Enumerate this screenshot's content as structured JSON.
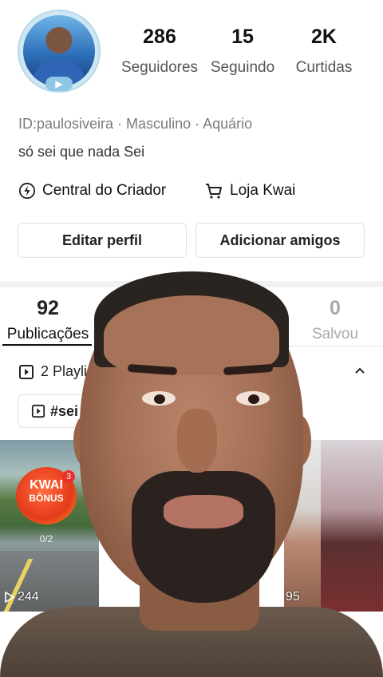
{
  "profile": {
    "stats": [
      {
        "value": "286",
        "label": "Seguidores"
      },
      {
        "value": "15",
        "label": "Seguindo"
      },
      {
        "value": "2K",
        "label": "Curtidas"
      }
    ],
    "meta": "ID:paulosiveira · Masculino · Aquário",
    "bio": "só sei que nada Sei",
    "creator_center": "Central do Criador",
    "shop": "Loja Kwai",
    "edit_profile": "Editar perfil",
    "add_friends": "Adicionar amigos"
  },
  "tabs": [
    {
      "count": "92",
      "label": "Publicações"
    },
    {
      "count": "0",
      "label": "Salvou"
    }
  ],
  "playlist": {
    "label": "2 Playli",
    "chip": "#sei"
  },
  "thumbs": {
    "kwai_title": "KWAI",
    "kwai_sub": "BÔNUS",
    "kwai_badge": "3",
    "progress": "0/2",
    "views_left": "244",
    "views_right": "95"
  },
  "colors": {
    "accent_underline": "#111111",
    "divider": "#f1f1f1"
  }
}
